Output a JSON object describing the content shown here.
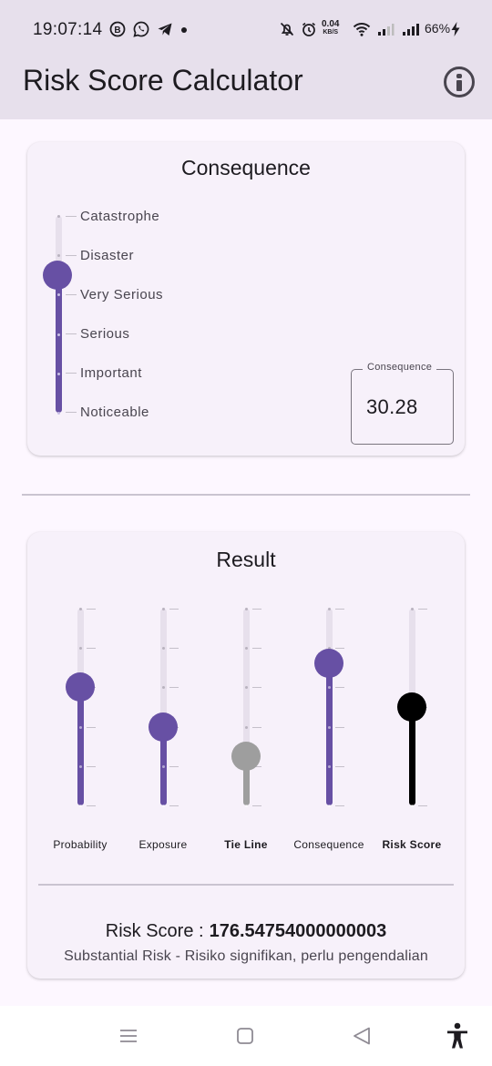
{
  "status_bar": {
    "time": "19:07:14",
    "net_speed_value": "0.04",
    "net_speed_unit": "KB/S",
    "battery_percent": "66%",
    "icons": [
      "beeper-icon",
      "whatsapp-icon",
      "telegram-icon",
      "notification-dot-icon",
      "bell-off-icon",
      "alarm-icon",
      "wifi-icon",
      "signal-icon",
      "signal-icon",
      "charging-icon"
    ]
  },
  "app_bar": {
    "title": "Risk Score Calculator",
    "info_icon": "info-icon"
  },
  "consequence_card": {
    "title": "Consequence",
    "levels": [
      "Catastrophe",
      "Disaster",
      "Very Serious",
      "Serious",
      "Important",
      "Noticeable"
    ],
    "slider_fraction": 0.7,
    "output_label": "Consequence",
    "output_value": "30.28"
  },
  "result_card": {
    "title": "Result",
    "sliders": [
      {
        "label": "Probability",
        "bold": false,
        "fraction": 0.6,
        "color": "#6750a4"
      },
      {
        "label": "Exposure",
        "bold": false,
        "fraction": 0.4,
        "color": "#6750a4"
      },
      {
        "label": "Tie Line",
        "bold": true,
        "fraction": 0.25,
        "color": "#9e9e9e"
      },
      {
        "label": "Consequence",
        "bold": false,
        "fraction": 0.72,
        "color": "#6750a4"
      },
      {
        "label": "Risk Score",
        "bold": true,
        "fraction": 0.5,
        "color": "#000000"
      }
    ],
    "risk_label": "Risk Score :",
    "risk_value": "176.54754000000003",
    "risk_description": "Substantial Risk - Risiko signifikan, perlu pengendalian"
  },
  "colors": {
    "accent": "#6750a4",
    "app_bar_bg": "#e7e0ec",
    "background": "#fdf7ff",
    "card_bg": "#f7f1fa"
  },
  "nav_bar": {
    "icons": [
      "menu-icon",
      "home-icon",
      "back-icon",
      "accessibility-icon"
    ]
  }
}
